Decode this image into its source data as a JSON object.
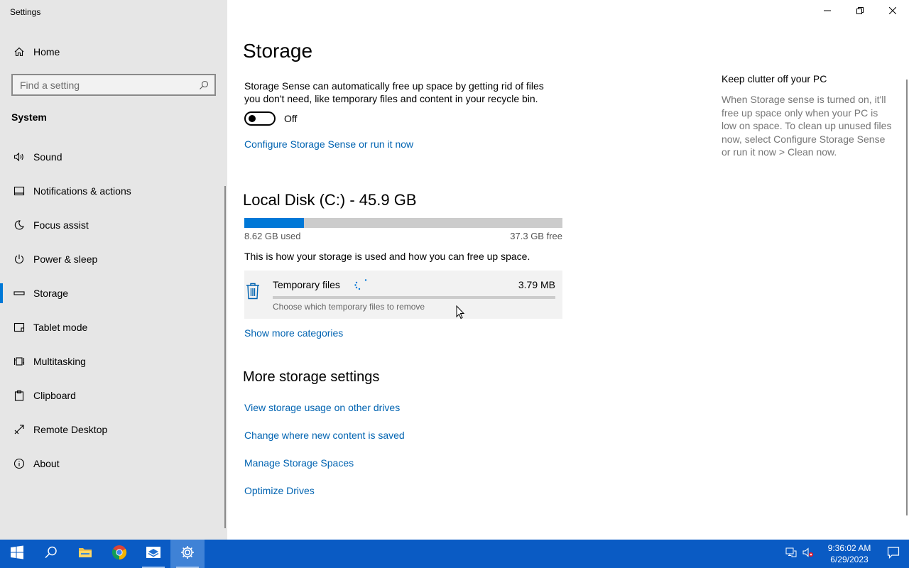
{
  "window": {
    "title": "Settings",
    "controls": {
      "minimize": "minimize-icon",
      "restore": "restore-icon",
      "close": "close-icon"
    }
  },
  "sidebar": {
    "home_label": "Home",
    "search_placeholder": "Find a setting",
    "section_label": "System",
    "items": [
      {
        "label": "Sound",
        "icon": "speaker-icon"
      },
      {
        "label": "Notifications & actions",
        "icon": "notification-icon"
      },
      {
        "label": "Focus assist",
        "icon": "moon-icon"
      },
      {
        "label": "Power & sleep",
        "icon": "power-icon"
      },
      {
        "label": "Storage",
        "icon": "storage-drive-icon",
        "active": true
      },
      {
        "label": "Tablet mode",
        "icon": "tablet-icon"
      },
      {
        "label": "Multitasking",
        "icon": "multitasking-icon"
      },
      {
        "label": "Clipboard",
        "icon": "clipboard-icon"
      },
      {
        "label": "Remote Desktop",
        "icon": "remote-desktop-icon"
      },
      {
        "label": "About",
        "icon": "info-icon"
      }
    ]
  },
  "main": {
    "title": "Storage",
    "storage_sense": {
      "description": "Storage Sense can automatically free up space by getting rid of files you don't need, like temporary files and content in your recycle bin.",
      "toggle_state": "Off",
      "configure_link": "Configure Storage Sense or run it now"
    },
    "disk": {
      "title": "Local Disk (C:) - 45.9 GB",
      "used": "8.62 GB used",
      "free": "37.3 GB free",
      "used_fraction": 0.188
    },
    "usage_description": "This is how your storage is used and how you can free up space.",
    "categories": [
      {
        "label": "Temporary files",
        "size": "3.79 MB",
        "subtitle": "Choose which temporary files to remove",
        "fraction": 0.0,
        "icon": "trash-icon"
      }
    ],
    "show_more": "Show more categories",
    "more_settings": {
      "title": "More storage settings",
      "links": [
        "View storage usage on other drives",
        "Change where new content is saved",
        "Manage Storage Spaces",
        "Optimize Drives"
      ]
    },
    "tip": {
      "title": "Keep clutter off your PC",
      "body": "When Storage sense is turned on, it'll free up space only when your PC is low on space. To clean up unused files now, select Configure Storage Sense or run it now > Clean now."
    }
  },
  "taskbar": {
    "apps": [
      "start-icon",
      "search-icon",
      "file-explorer-icon",
      "chrome-icon",
      "mail-app-icon",
      "settings-gear-icon"
    ],
    "time": "9:36:02 AM",
    "date": "6/29/2023",
    "colors": {
      "taskbar": "#0a5bc4",
      "accent": "#0078d7"
    }
  }
}
